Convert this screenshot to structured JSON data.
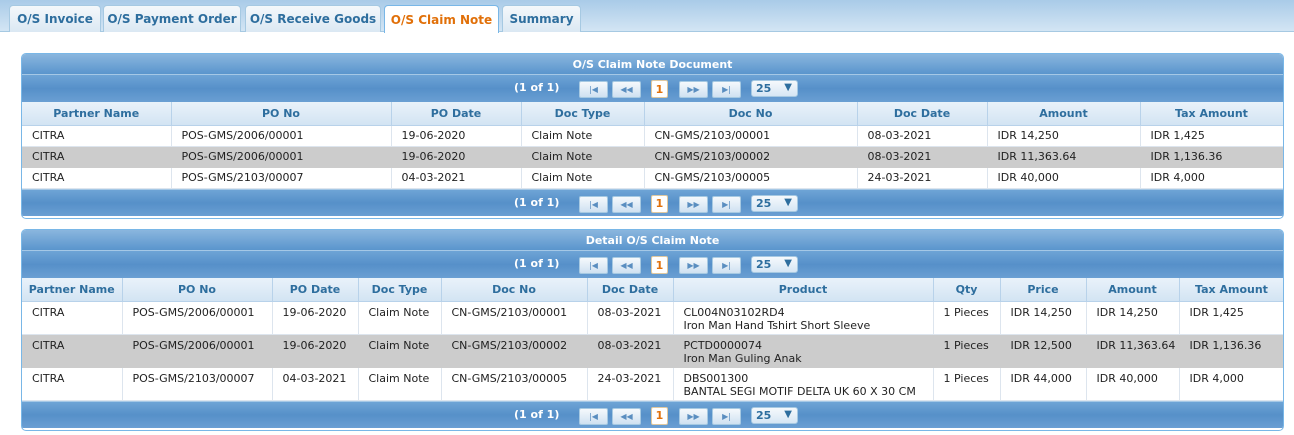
{
  "tabs": [
    {
      "label": "O/S Invoice"
    },
    {
      "label": "O/S Payment Order"
    },
    {
      "label": "O/S Receive Goods"
    },
    {
      "label": "O/S Claim Note"
    },
    {
      "label": "Summary"
    }
  ],
  "doc_panel": {
    "title": "O/S Claim Note Document",
    "pager": {
      "count": "(1 of 1)",
      "page": "1",
      "page_size": "25",
      "first": "◄◄",
      "prev": "◄◄",
      "next": "►►",
      "last": "►◄"
    },
    "columns": [
      "Partner Name",
      "PO No",
      "PO Date",
      "Doc Type",
      "Doc No",
      "Doc Date",
      "Amount",
      "Tax Amount"
    ],
    "rows": [
      [
        "CITRA",
        "POS-GMS/2006/00001",
        "19-06-2020",
        "Claim Note",
        "CN-GMS/2103/00001",
        "08-03-2021",
        "IDR 14,250",
        "IDR 1,425"
      ],
      [
        "CITRA",
        "POS-GMS/2006/00001",
        "19-06-2020",
        "Claim Note",
        "CN-GMS/2103/00002",
        "08-03-2021",
        "IDR 11,363.64",
        "IDR 1,136.36"
      ],
      [
        "CITRA",
        "POS-GMS/2103/00007",
        "04-03-2021",
        "Claim Note",
        "CN-GMS/2103/00005",
        "24-03-2021",
        "IDR 40,000",
        "IDR 4,000"
      ]
    ]
  },
  "detail_panel": {
    "title": "Detail O/S Claim Note",
    "pager": {
      "count": "(1 of 1)",
      "page": "1",
      "page_size": "25"
    },
    "columns": [
      "Partner Name",
      "PO No",
      "PO Date",
      "Doc Type",
      "Doc No",
      "Doc Date",
      "Product",
      "Qty",
      "Price",
      "Amount",
      "Tax Amount"
    ],
    "rows": [
      [
        "CITRA",
        "POS-GMS/2006/00001",
        "19-06-2020",
        "Claim Note",
        "CN-GMS/2103/00001",
        "08-03-2021",
        "CL004N03102RD4",
        "Iron Man Hand Tshirt Short Sleeve",
        "1 Pieces",
        "IDR 14,250",
        "IDR 14,250",
        "IDR 1,425"
      ],
      [
        "CITRA",
        "POS-GMS/2006/00001",
        "19-06-2020",
        "Claim Note",
        "CN-GMS/2103/00002",
        "08-03-2021",
        "PCTD0000074",
        "Iron Man Guling Anak",
        "1 Pieces",
        "IDR 12,500",
        "IDR 11,363.64",
        "IDR 1,136.36"
      ],
      [
        "CITRA",
        "POS-GMS/2103/00007",
        "04-03-2021",
        "Claim Note",
        "CN-GMS/2103/00005",
        "24-03-2021",
        "DBS001300",
        "BANTAL SEGI MOTIF DELTA UK 60 X 30 CM",
        "1 Pieces",
        "IDR 44,000",
        "IDR 40,000",
        "IDR 4,000"
      ]
    ]
  },
  "active_tab_index": 3,
  "colors": {
    "accent": "#e17009",
    "header_text": "#2e6e9e",
    "pager_bg": "#5a95cd",
    "alt_row": "#cccccc"
  }
}
